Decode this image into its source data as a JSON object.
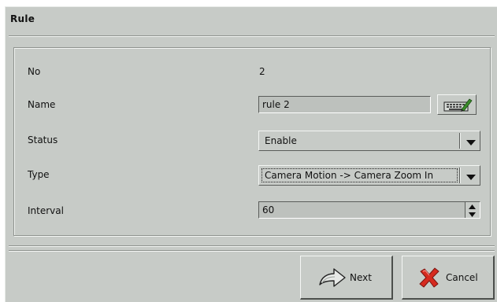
{
  "dialog": {
    "title": "Rule"
  },
  "form": {
    "no": {
      "label": "No",
      "value": "2"
    },
    "name": {
      "label": "Name",
      "value": "rule 2",
      "keyboard_icon": "keyboard-pen-icon"
    },
    "status": {
      "label": "Status",
      "selected": "Enable",
      "icon": "chevron-down-icon"
    },
    "type": {
      "label": "Type",
      "selected": "Camera Motion -> Camera Zoom In",
      "icon": "chevron-down-icon"
    },
    "interval": {
      "label": "Interval",
      "value": "60",
      "icon": "spin-arrows-icon"
    }
  },
  "buttons": {
    "next": {
      "label": "Next",
      "icon": "arrow-right-icon"
    },
    "cancel": {
      "label": "Cancel",
      "icon": "x-icon"
    }
  }
}
